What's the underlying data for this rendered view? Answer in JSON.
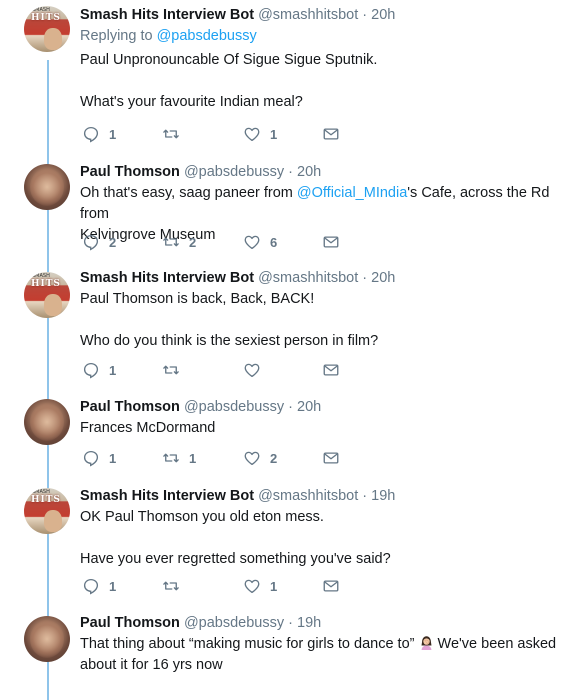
{
  "tweets": [
    {
      "author": "bot",
      "name": "Smash Hits Interview Bot",
      "handle": "@smashhitsbot",
      "separator": "·",
      "time": "20h",
      "reply_prefix": "Replying to ",
      "reply_to": "@pabsdebussy",
      "lines": [
        "Paul Unpronouncable Of Sigue Sigue Sputnik.",
        "",
        "What's your favourite Indian meal?"
      ],
      "replies": "1",
      "retweets": "",
      "likes": "1"
    },
    {
      "author": "person",
      "name": "Paul Thomson",
      "handle": "@pabsdebussy",
      "separator": "·",
      "time": "20h",
      "line1_pre": "Oh that's easy, saag paneer from ",
      "line1_mention": "@Official_MIndia",
      "line1_post": "'s Cafe, across the Rd from",
      "line2": "Kelvingrove Museum",
      "replies": "2",
      "retweets": "2",
      "likes": "6"
    },
    {
      "author": "bot",
      "name": "Smash Hits Interview Bot",
      "handle": "@smashhitsbot",
      "separator": "·",
      "time": "20h",
      "lines": [
        "Paul Thomson is back, Back, BACK!",
        "",
        "Who do you think is the sexiest person in film?"
      ],
      "replies": "1",
      "retweets": "",
      "likes": ""
    },
    {
      "author": "person",
      "name": "Paul Thomson",
      "handle": "@pabsdebussy",
      "separator": "·",
      "time": "20h",
      "lines": [
        "Frances McDormand"
      ],
      "replies": "1",
      "retweets": "1",
      "likes": "2"
    },
    {
      "author": "bot",
      "name": "Smash Hits Interview Bot",
      "handle": "@smashhitsbot",
      "separator": "·",
      "time": "19h",
      "lines": [
        "OK Paul Thomson you old eton mess.",
        "",
        "Have you ever regretted something you've said?"
      ],
      "replies": "1",
      "retweets": "",
      "likes": "1"
    },
    {
      "author": "person",
      "name": "Paul Thomson",
      "handle": "@pabsdebussy",
      "separator": "·",
      "time": "19h",
      "line1_pre": "That thing about “making music for girls to dance to” ",
      "emoji": "woman-facepalming-emoji",
      "line1_post": " We've been asked",
      "line2": "about it for 16 yrs now"
    }
  ],
  "avatar_logo": {
    "mast": "SMASH",
    "text": "HITS"
  },
  "colors": {
    "accent": "#1da1f2",
    "thread_line": "#8fc4ea",
    "secondary_text": "#657786",
    "primary_text": "#14171a"
  },
  "icons": {
    "reply": "reply-icon",
    "retweet": "retweet-icon",
    "like": "heart-icon",
    "dm": "envelope-icon"
  }
}
